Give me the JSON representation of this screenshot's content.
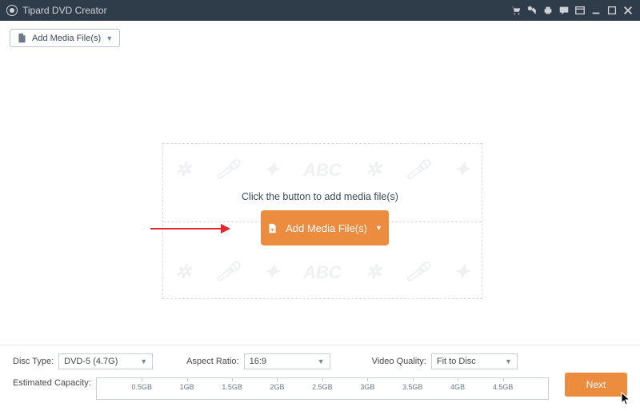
{
  "titlebar": {
    "title": "Tipard DVD Creator"
  },
  "toolbar": {
    "add_media_label": "Add Media File(s)"
  },
  "canvas": {
    "bg_text": "ABC",
    "prompt": "Click the button to add media file(s)",
    "primary_button": "Add Media File(s)"
  },
  "footer": {
    "disc_type_label": "Disc Type:",
    "disc_type_value": "DVD-5 (4.7G)",
    "aspect_ratio_label": "Aspect Ratio:",
    "aspect_ratio_value": "16:9",
    "video_quality_label": "Video Quality:",
    "video_quality_value": "Fit to Disc",
    "estimated_capacity_label": "Estimated Capacity:",
    "capacity_ticks": [
      "0.5GB",
      "1GB",
      "1.5GB",
      "2GB",
      "2.5GB",
      "3GB",
      "3.5GB",
      "4GB",
      "4.5GB"
    ],
    "next_label": "Next"
  }
}
